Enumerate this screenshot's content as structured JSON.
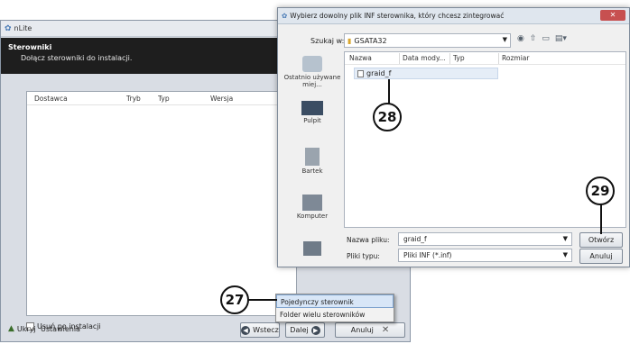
{
  "nlite": {
    "title": "nLite",
    "header_title": "Sterowniki",
    "header_subtitle": "Dołącz sterowniki do instalacji.",
    "columns": [
      "Dostawca",
      "Tryb",
      "Typ",
      "Wersja"
    ],
    "remove_after_install": "Usuń po instalacji",
    "hide": "Ukryj",
    "settings": "Ustawienia",
    "back": "Wstecz",
    "next": "Dalej",
    "cancel": "Anuluj"
  },
  "popup": {
    "items": [
      "Pojedynczy sterownik",
      "Folder wielu sterowników"
    ]
  },
  "dialog": {
    "title": "Wybierz dowolny plik INF sterownika, który chcesz zintegrować",
    "look_in_label": "Szukaj w:",
    "look_in_value": "GSATA32",
    "places": [
      "Ostatnio używane miej...",
      "Pulpit",
      "Bartek",
      "Komputer"
    ],
    "columns": [
      "Nazwa",
      "Data mody...",
      "Typ",
      "Rozmiar"
    ],
    "file": "graid_f",
    "filename_label": "Nazwa pliku:",
    "filename_value": "graid_f",
    "filetype_label": "Pliki typu:",
    "filetype_value": "Pliki INF (*.inf)",
    "open": "Otwórz",
    "cancel": "Anuluj"
  },
  "callouts": {
    "c27": "27",
    "c28": "28",
    "c29": "29"
  }
}
